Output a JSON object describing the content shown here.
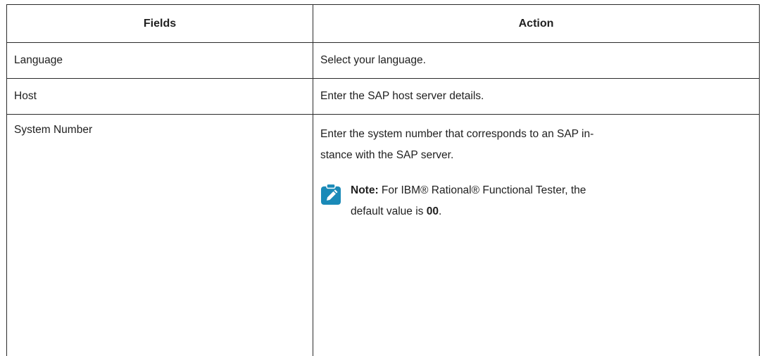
{
  "table": {
    "headers": {
      "fields": "Fields",
      "action": "Action"
    },
    "rows": [
      {
        "field": "Language",
        "action": "Select your language."
      },
      {
        "field": "Host",
        "action": "Enter the SAP host server details."
      },
      {
        "field": "System Number",
        "action_line1": "Enter the system number that corresponds to an SAP in-",
        "action_line2": "stance with the SAP server.",
        "note": {
          "icon": "note-pencil-icon",
          "label": "Note:",
          "line1_text": " For IBM® Rational® Functional Tester, the",
          "line2_text": "default value is ",
          "value": "00",
          "end": "."
        }
      }
    ]
  },
  "colors": {
    "note_icon": "#1a8ab8",
    "border": "#2a2a2a",
    "text": "#1f1f1f"
  }
}
